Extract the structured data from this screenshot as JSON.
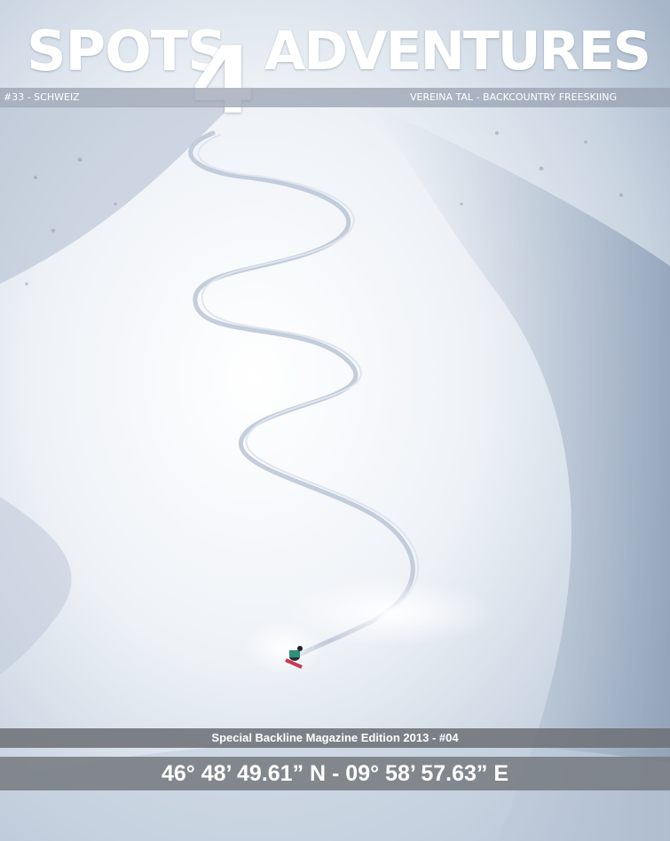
{
  "masthead": {
    "title_left": "SPOTS",
    "title_number": "4",
    "title_right": "ADVENTURES"
  },
  "info_bar": {
    "issue": "#33 - SCHWEIZ",
    "subject": "VEREINA TAL - BACKCOUNTRY FREESKIING"
  },
  "footer": {
    "edition": "Special Backline Magazine Edition 2013 - #04",
    "coordinates": "46° 48’ 49.61” N - 09° 58’ 57.63” E"
  },
  "colors": {
    "snow_light": "#f4f7fb",
    "snow_shadow": "#9eb0c6",
    "bar_gray": "#6e7278",
    "title_white": "#ffffff"
  }
}
